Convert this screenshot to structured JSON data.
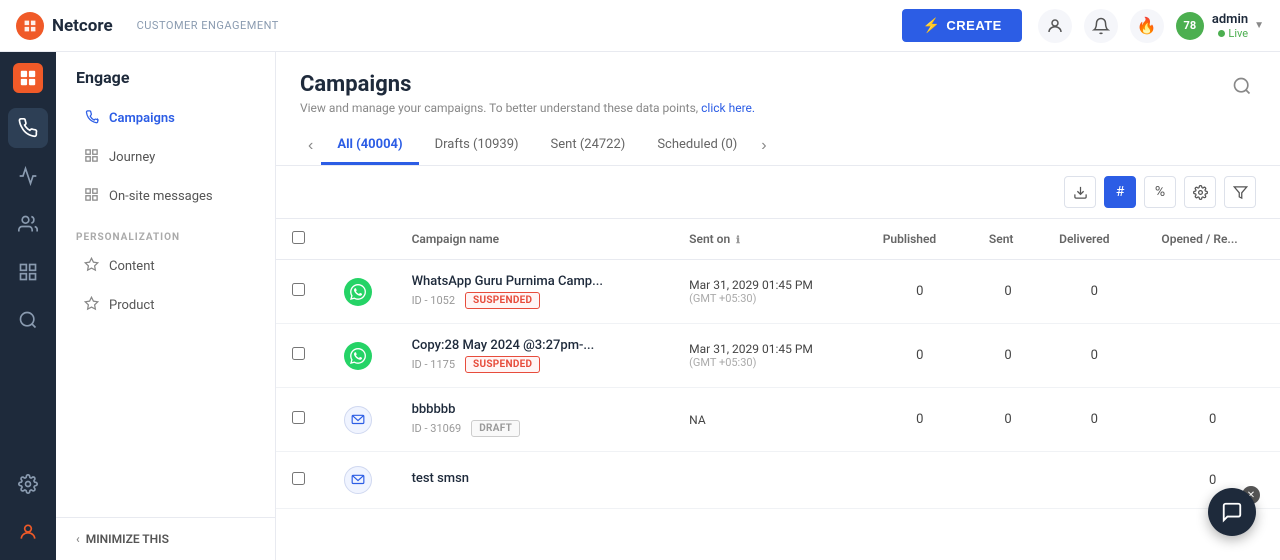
{
  "header": {
    "logo_text": "Netcore",
    "logo_icon": "N",
    "subtitle": "CUSTOMER ENGAGEMENT",
    "create_label": "CREATE",
    "admin_name": "admin",
    "admin_status": "Live",
    "badge_number": "78"
  },
  "sidebar": {
    "title": "Engage",
    "items": [
      {
        "id": "campaigns",
        "label": "Campaigns",
        "icon": "⚙",
        "active": true
      },
      {
        "id": "journey",
        "label": "Journey",
        "icon": "⊞",
        "active": false
      },
      {
        "id": "onsite",
        "label": "On-site messages",
        "icon": "⊞",
        "active": false
      }
    ],
    "personalization_label": "PERSONALIZATION",
    "personalization_items": [
      {
        "id": "content",
        "label": "Content",
        "icon": "◈"
      },
      {
        "id": "product",
        "label": "Product",
        "icon": "◈"
      }
    ],
    "minimize_label": "MINIMIZE THIS"
  },
  "page": {
    "title": "Campaigns",
    "subtitle": "View and manage your campaigns. To better understand these data points,",
    "subtitle_link": "click here."
  },
  "tabs": [
    {
      "id": "all",
      "label": "All (40004)",
      "active": true
    },
    {
      "id": "drafts",
      "label": "Drafts (10939)",
      "active": false
    },
    {
      "id": "sent",
      "label": "Sent (24722)",
      "active": false
    },
    {
      "id": "scheduled",
      "label": "Scheduled (0)",
      "active": false
    }
  ],
  "table": {
    "columns": [
      "Campaign name",
      "Sent on",
      "Published",
      "Sent",
      "Delivered",
      "Opened / Re..."
    ],
    "rows": [
      {
        "name": "WhatsApp Guru Purnima Camp...",
        "id": "ID - 1052",
        "status": "SUSPENDED",
        "status_type": "suspended",
        "channel": "whatsapp",
        "sent_on": "Mar 31, 2029 01:45 PM",
        "timezone": "(GMT +05:30)",
        "published": "0",
        "sent": "0",
        "delivered": "0",
        "opened": ""
      },
      {
        "name": "Copy:28 May 2024 @3:27pm-...",
        "id": "ID - 1175",
        "status": "SUSPENDED",
        "status_type": "suspended",
        "channel": "whatsapp",
        "sent_on": "Mar 31, 2029 01:45 PM",
        "timezone": "(GMT +05:30)",
        "published": "0",
        "sent": "0",
        "delivered": "0",
        "opened": ""
      },
      {
        "name": "bbbbbb",
        "id": "ID - 31069",
        "status": "DRAFT",
        "status_type": "draft",
        "channel": "sms",
        "sent_on": "NA",
        "timezone": "",
        "published": "0",
        "sent": "0",
        "delivered": "0",
        "opened": "0"
      },
      {
        "name": "test smsn",
        "id": "",
        "status": "",
        "status_type": "",
        "channel": "sms",
        "sent_on": "",
        "timezone": "",
        "published": "",
        "sent": "",
        "delivered": "",
        "opened": "0"
      }
    ]
  }
}
